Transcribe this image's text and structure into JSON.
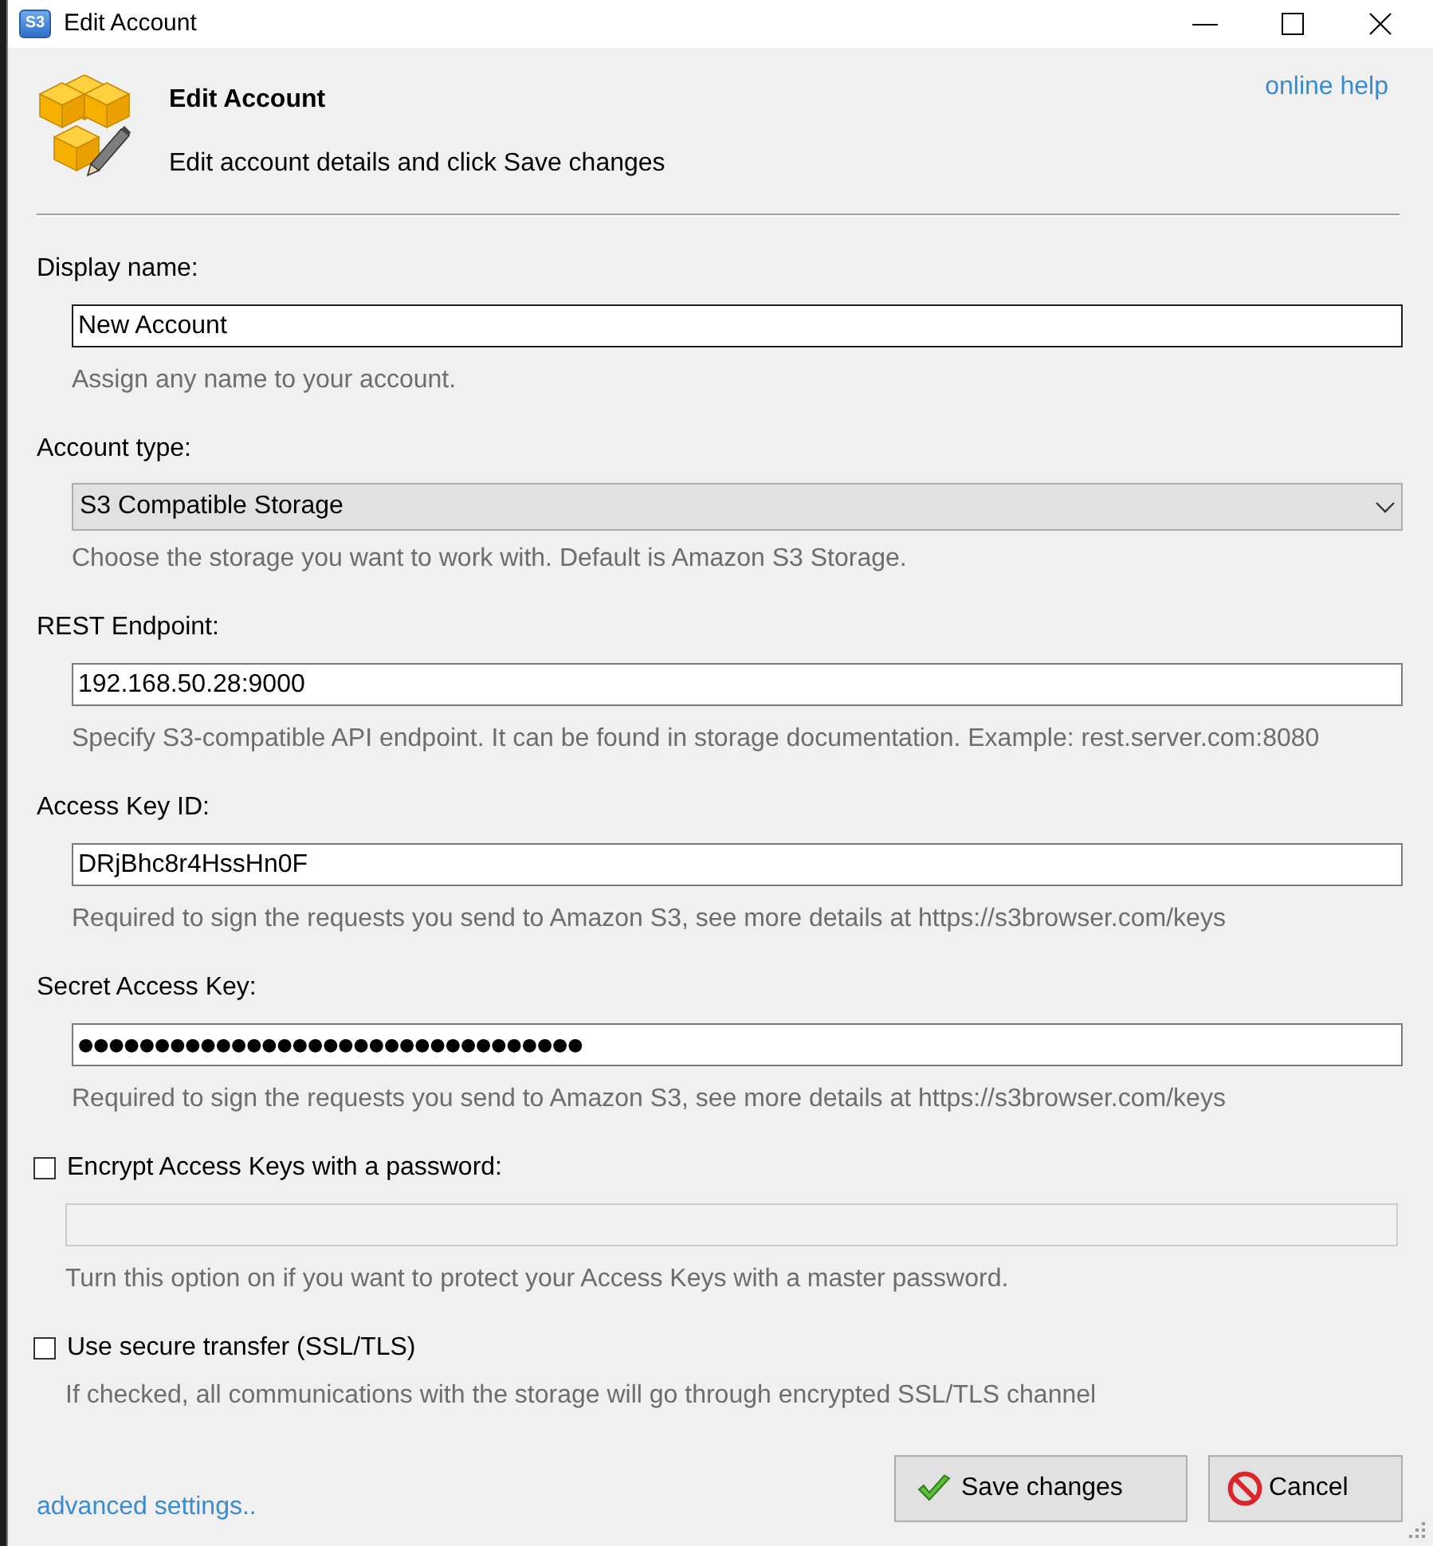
{
  "window": {
    "icon_label": "S3",
    "title": "Edit Account"
  },
  "header": {
    "title": "Edit Account",
    "subtitle": "Edit account details and click Save changes",
    "help_link": "online help"
  },
  "fields": [
    {
      "kind": "text",
      "label": "Display name:",
      "value": "New Account",
      "focused": true,
      "hint": "Assign any name to your account."
    },
    {
      "kind": "select",
      "label": "Account type:",
      "value": "S3 Compatible Storage",
      "focused": false,
      "hint": "Choose the storage you want to work with. Default is Amazon S3 Storage."
    },
    {
      "kind": "text",
      "label": "REST Endpoint:",
      "value": "192.168.50.28:9000",
      "focused": false,
      "hint": "Specify S3-compatible API endpoint. It can be found in storage documentation. Example: rest.server.com:8080"
    },
    {
      "kind": "text",
      "label": "Access Key ID:",
      "value": "DRjBhc8r4HssHn0F",
      "focused": false,
      "hint": "Required to sign the requests you send to Amazon S3, see more details at https://s3browser.com/keys"
    },
    {
      "kind": "password",
      "label": "Secret Access Key:",
      "value": "●●●●●●●●●●●●●●●●●●●●●●●●●●●●●●●●●",
      "focused": false,
      "hint": "Required to sign the requests you send to Amazon S3, see more details at https://s3browser.com/keys"
    }
  ],
  "options": [
    {
      "label": "Encrypt Access Keys with a password:",
      "checked": false,
      "input": {
        "disabled": true
      },
      "hint": "Turn this option on if you want to protect your Access Keys with a master password."
    },
    {
      "label": "Use secure transfer (SSL/TLS)",
      "checked": false,
      "hint": "If checked, all communications with the storage will go through encrypted SSL/TLS channel"
    }
  ],
  "footer": {
    "link": "advanced settings..",
    "buttons": [
      {
        "kind": "save",
        "label": "Save changes"
      },
      {
        "kind": "cancel",
        "label": "Cancel"
      }
    ]
  }
}
